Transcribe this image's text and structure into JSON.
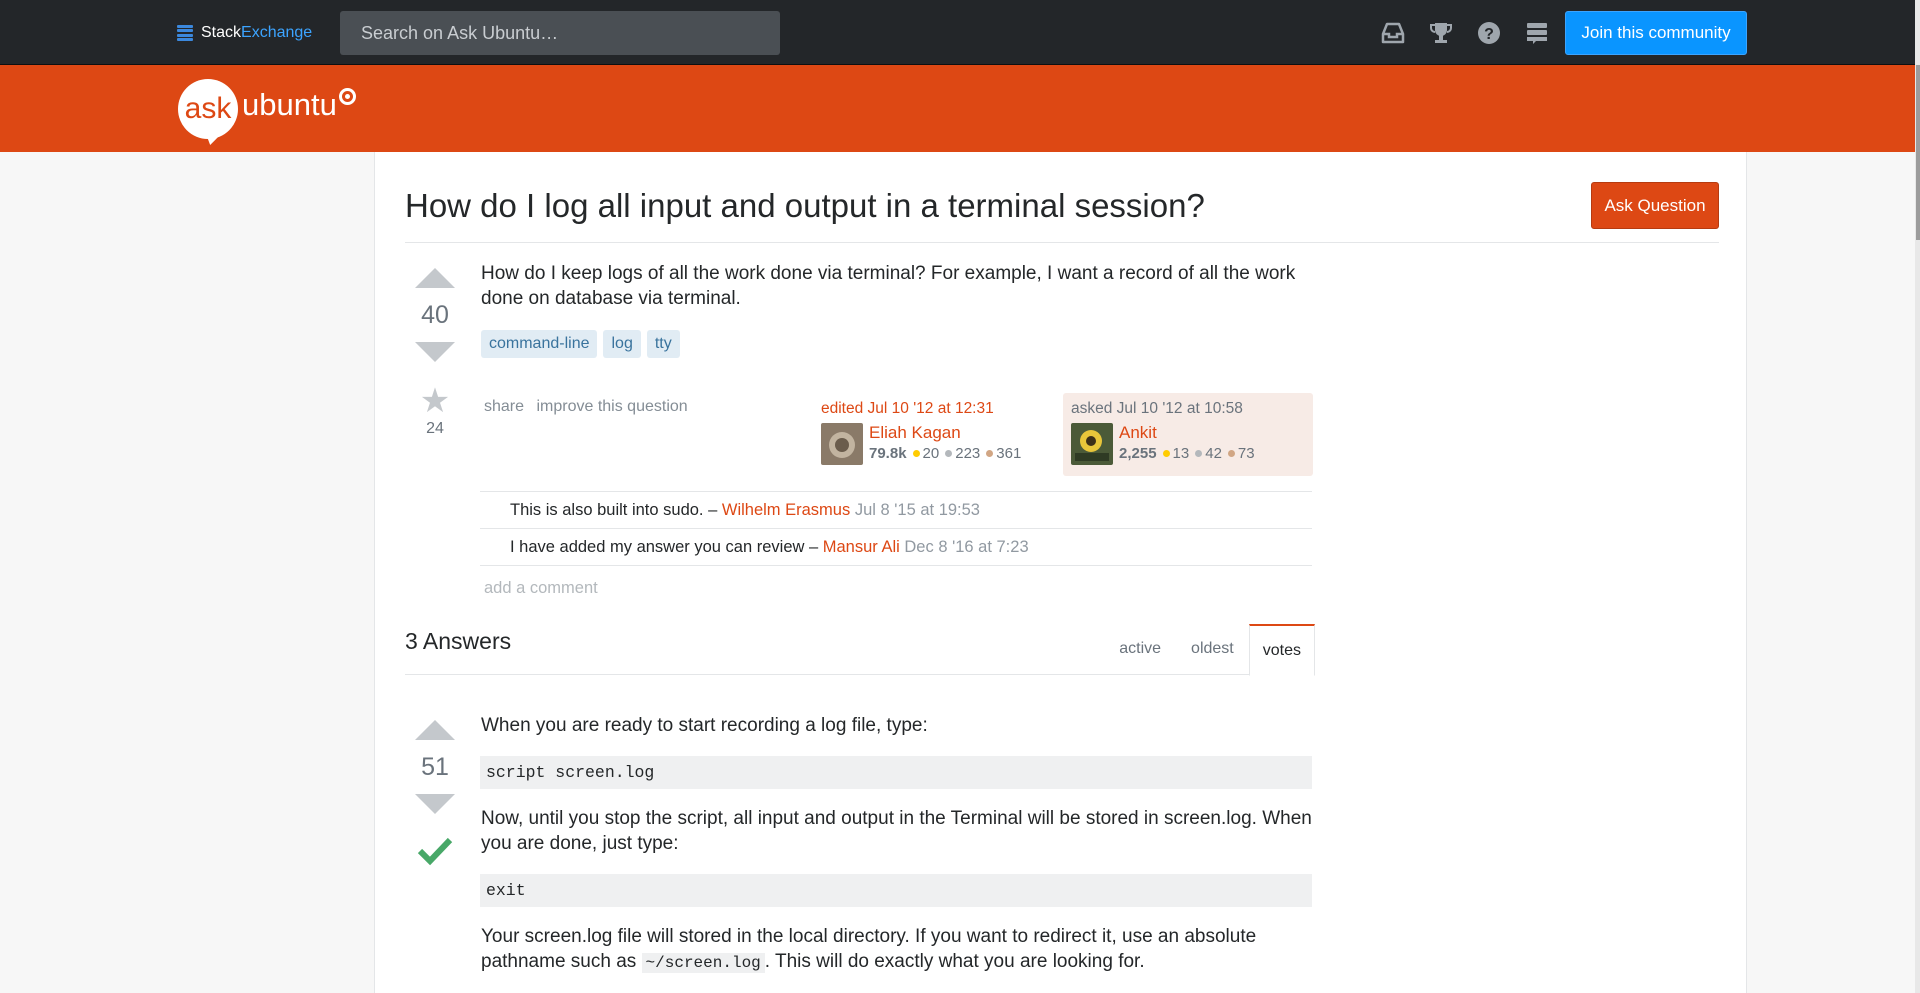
{
  "topbar": {
    "logo_stack": "Stack",
    "logo_exchange": "Exchange",
    "search_placeholder": "Search on Ask Ubuntu…",
    "join_label": "Join this community",
    "icons": [
      "inbox-icon",
      "achievements-icon",
      "help-icon",
      "site-switcher-icon"
    ]
  },
  "site": {
    "logo_ask": "ask",
    "logo_ubuntu": "ubuntu",
    "brand_color": "#dd4814"
  },
  "question": {
    "title": "How do I log all input and output in a terminal session?",
    "ask_button": "Ask Question",
    "votes": "40",
    "favorites": "24",
    "body": "How do I keep logs of all the work done via terminal? For example, I want a record of all the work done on database via terminal.",
    "tags": [
      "command-line",
      "log",
      "tty"
    ],
    "menu": {
      "share": "share",
      "improve": "improve this question"
    },
    "editor": {
      "action": "edited Jul 10 '12 at 12:31",
      "name": "Eliah Kagan",
      "rep": "79.8k",
      "gold": "20",
      "silver": "223",
      "bronze": "361"
    },
    "owner": {
      "action": "asked Jul 10 '12 at 10:58",
      "name": "Ankit",
      "rep": "2,255",
      "gold": "13",
      "silver": "42",
      "bronze": "73"
    },
    "comments": [
      {
        "text": "This is also built into sudo. –",
        "user": "Wilhelm Erasmus",
        "date": "Jul 8 '15 at 19:53"
      },
      {
        "text": "I have added my answer you can review –",
        "user": "Mansur Ali",
        "date": "Dec 8 '16 at 7:23"
      }
    ],
    "add_comment": "add a comment"
  },
  "answers": {
    "count_label": "3 Answers",
    "tabs": [
      "active",
      "oldest",
      "votes"
    ],
    "active_tab": "votes",
    "first": {
      "votes": "51",
      "accepted": true,
      "p1": "When you are ready to start recording a log file, type:",
      "code1": "script screen.log",
      "p2": "Now, until you stop the script, all input and output in the Terminal will be stored in screen.log. When you are done, just type:",
      "code2": "exit",
      "p3_before": "Your screen.log file will stored in the local directory. If you want to redirect it, use an absolute pathname such as",
      "p3_code": "~/screen.log",
      "p3_after": ". This will do exactly what you are looking for."
    }
  }
}
